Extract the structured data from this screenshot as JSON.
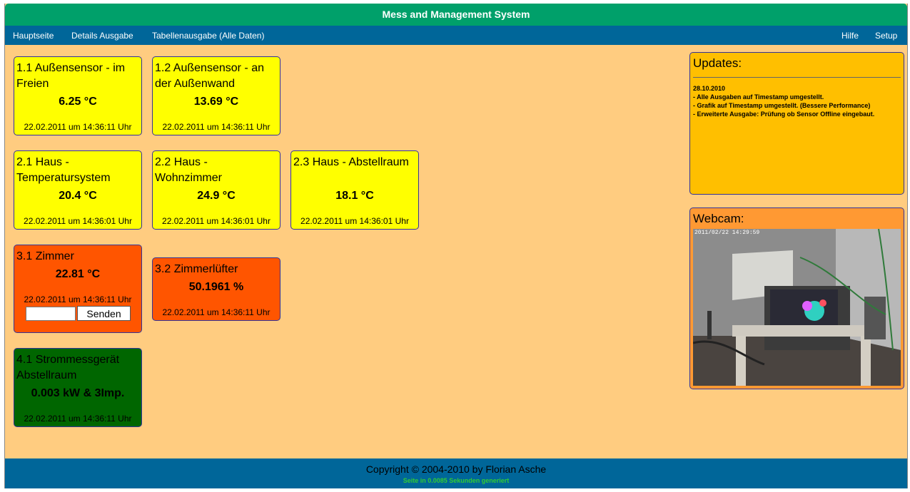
{
  "app": {
    "title": "Mess and Management System"
  },
  "nav": {
    "left": [
      "Hauptseite",
      "Details Ausgabe",
      "Tabellenausgabe (Alle Daten)"
    ],
    "right": [
      "Hilfe",
      "Setup"
    ]
  },
  "tiles": [
    {
      "title": "1.1 Außensensor - im Freien",
      "value": "6.25 °C",
      "time": "22.02.2011 um 14:36:11 Uhr",
      "color": "#ffff00"
    },
    {
      "title": "1.2 Außensensor - an der Außenwand",
      "value": "13.69 °C",
      "time": "22.02.2011 um 14:36:11 Uhr",
      "color": "#ffff00"
    },
    {
      "title": "2.1 Haus - Temperatursystem",
      "value": "20.4 °C",
      "time": "22.02.2011 um 14:36:01 Uhr",
      "color": "#ffff00"
    },
    {
      "title": "2.2 Haus - Wohnzimmer",
      "value": "24.9 °C",
      "time": "22.02.2011 um 14:36:01 Uhr",
      "color": "#ffff00"
    },
    {
      "title": "2.3 Haus - Abstellraum",
      "value": "18.1 °C",
      "time": "22.02.2011 um 14:36:01 Uhr",
      "color": "#ffff00"
    },
    {
      "title": "3.1 Zimmer",
      "value": "22.81 °C",
      "time": "22.02.2011 um 14:36:11 Uhr",
      "color": "#ff5500",
      "input_value": "",
      "button_label": "Senden"
    },
    {
      "title": "3.2 Zimmerlüfter",
      "value": "50.1961 %",
      "time": "22.02.2011 um 14:36:11 Uhr",
      "color": "#ff5500"
    },
    {
      "title": "4.1 Strommessgerät Abstellraum",
      "value": "0.003 kW & 3Imp.",
      "time": "22.02.2011 um 14:36:11 Uhr",
      "color": "#006600"
    }
  ],
  "updates": {
    "heading": "Updates:",
    "date": "28.10.2010",
    "items": [
      "- Alle Ausgaben auf Timestamp umgestellt.",
      "- Grafik auf Timestamp umgestellt. (Bessere Performance)",
      "- Erweiterte Ausgabe: Prüfung ob Sensor Offline eingebaut."
    ]
  },
  "webcam": {
    "heading": "Webcam:",
    "timestamp": "2011/02/22 14:29:59"
  },
  "footer": {
    "copyright": "Copyright © 2004-2010 by Florian Asche",
    "generated": "Seite in 0.0085 Sekunden generiert"
  }
}
